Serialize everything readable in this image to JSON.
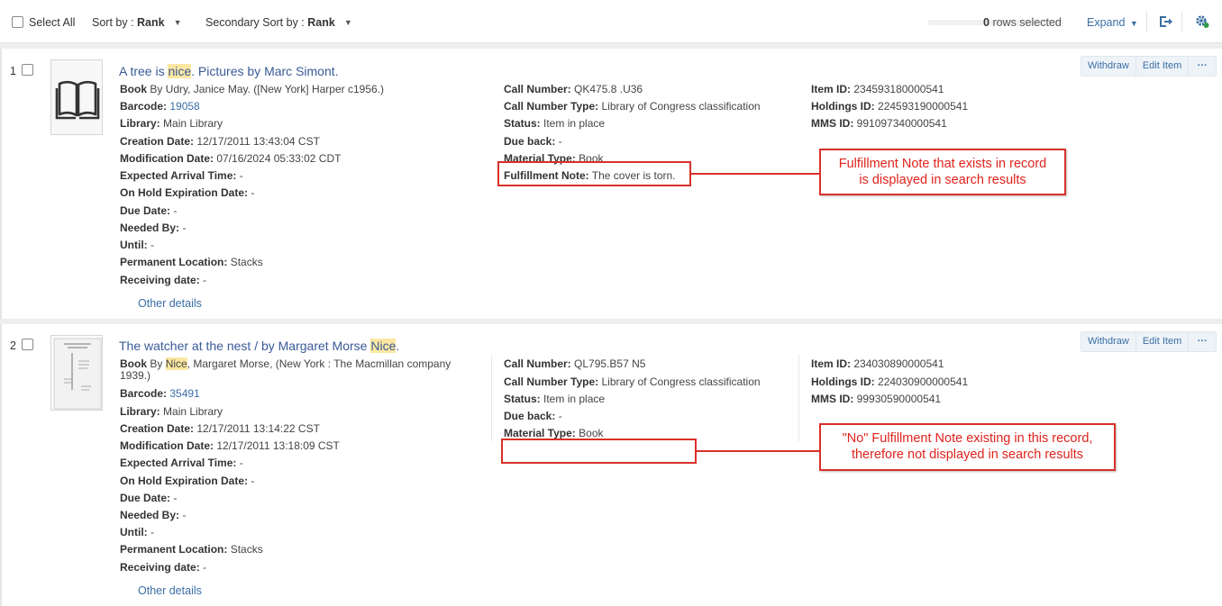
{
  "toolbar": {
    "select_all_label": "Select All",
    "sort_label": "Sort by :",
    "sort_value": "Rank",
    "secondary_sort_label": "Secondary Sort by :",
    "secondary_sort_value": "Rank",
    "rows_selected_count": "0",
    "rows_selected_label": "rows selected",
    "expand_label": "Expand",
    "export_icon": "export-icon",
    "settings_icon": "settings-gear-icon"
  },
  "records": [
    {
      "number": "1",
      "title_pre": "A tree is ",
      "title_highlight": "nice",
      "title_post": ". Pictures by Marc Simont.",
      "thumbnail_icon": "book-icon",
      "book_label": "Book",
      "book_value_pre": "By Udry, Janice May. ([New York] Harper c1956.)",
      "barcode_label": "Barcode:",
      "barcode_value": "19058",
      "library_label": "Library:",
      "library_value": "Main Library",
      "creation_label": "Creation Date:",
      "creation_value": "12/17/2011 13:43:04 CST",
      "modification_label": "Modification Date:",
      "modification_value": "07/16/2024 05:33:02 CDT",
      "expected_arrival_label": "Expected Arrival Time:",
      "expected_arrival_value": "-",
      "on_hold_label": "On Hold Expiration Date:",
      "on_hold_value": "-",
      "due_date_label": "Due Date:",
      "due_date_value": "-",
      "needed_by_label": "Needed By:",
      "needed_by_value": "-",
      "until_label": "Until:",
      "until_value": "-",
      "permanent_location_label": "Permanent Location:",
      "permanent_location_value": "Stacks",
      "receiving_label": "Receiving date:",
      "receiving_value": "-",
      "other_details": "Other details",
      "call_number_label": "Call Number:",
      "call_number_value": "QK475.8 .U36",
      "call_number_type_label": "Call Number Type:",
      "call_number_type_value": "Library of Congress classification",
      "status_label": "Status:",
      "status_value": "Item in place",
      "due_back_label": "Due back:",
      "due_back_value": "-",
      "material_type_label": "Material Type:",
      "material_type_value": "Book",
      "fulfillment_note_label": "Fulfillment Note:",
      "fulfillment_note_value": "The cover is torn.",
      "item_id_label": "Item ID:",
      "item_id_value": "234593180000541",
      "holdings_id_label": "Holdings ID:",
      "holdings_id_value": "224593190000541",
      "mms_id_label": "MMS ID:",
      "mms_id_value": "991097340000541",
      "withdraw_label": "Withdraw",
      "edit_item_label": "Edit Item",
      "more_label": "···"
    },
    {
      "number": "2",
      "title_pre": "The watcher at the nest / by Margaret Morse ",
      "title_highlight": "Nice",
      "title_post": ".",
      "thumbnail_icon": "book-cover-thumbnail",
      "book_label": "Book",
      "book_value_pre": "By ",
      "book_value_highlight": "Nice",
      "book_value_post": ", Margaret Morse, (New York : The Macmillan company",
      "book_value_line2": "1939.)",
      "barcode_label": "Barcode:",
      "barcode_value": "35491",
      "library_label": "Library:",
      "library_value": "Main Library",
      "creation_label": "Creation Date:",
      "creation_value": "12/17/2011 13:14:22 CST",
      "modification_label": "Modification Date:",
      "modification_value": "12/17/2011 13:18:09 CST",
      "expected_arrival_label": "Expected Arrival Time:",
      "expected_arrival_value": "-",
      "on_hold_label": "On Hold Expiration Date:",
      "on_hold_value": "-",
      "due_date_label": "Due Date:",
      "due_date_value": "-",
      "needed_by_label": "Needed By:",
      "needed_by_value": "-",
      "until_label": "Until:",
      "until_value": "-",
      "permanent_location_label": "Permanent Location:",
      "permanent_location_value": "Stacks",
      "receiving_label": "Receiving date:",
      "receiving_value": "-",
      "other_details": "Other details",
      "call_number_label": "Call Number:",
      "call_number_value": "QL795.B57 N5",
      "call_number_type_label": "Call Number Type:",
      "call_number_type_value": "Library of Congress classification",
      "status_label": "Status:",
      "status_value": "Item in place",
      "due_back_label": "Due back:",
      "due_back_value": "-",
      "material_type_label": "Material Type:",
      "material_type_value": "Book",
      "item_id_label": "Item ID:",
      "item_id_value": "234030890000541",
      "holdings_id_label": "Holdings ID:",
      "holdings_id_value": "224030900000541",
      "mms_id_label": "MMS ID:",
      "mms_id_value": "99930590000541",
      "withdraw_label": "Withdraw",
      "edit_item_label": "Edit Item",
      "more_label": "···"
    }
  ],
  "annotations": {
    "callout_1_line1": "Fulfillment Note that exists in record",
    "callout_1_line2": "is displayed in search results",
    "callout_2_line1": "\"No\" Fulfillment Note existing in this record,",
    "callout_2_line2": "therefore not displayed in search results",
    "color": "#d9302a"
  },
  "colors": {
    "link": "#3a6ea5",
    "title": "#3a5a98",
    "highlight": "#fbe7a1",
    "annotation_red": "#d9302a"
  }
}
